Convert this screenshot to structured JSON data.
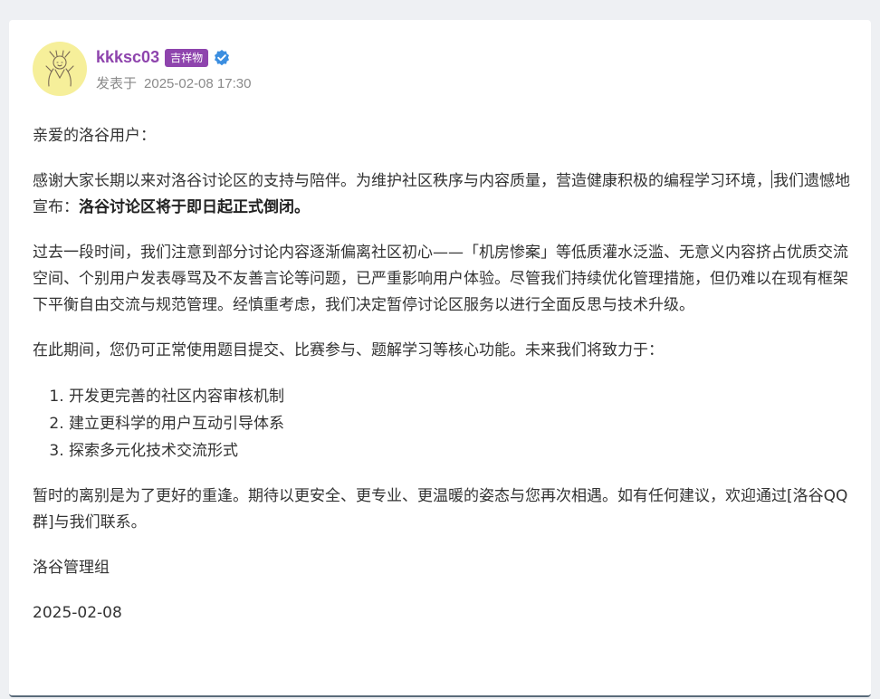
{
  "post": {
    "author": {
      "username": "kkksc03",
      "badge": "吉祥物",
      "verified_icon": "verified-check-icon",
      "avatar_icon": "avatar-sketch-icon"
    },
    "posted_label": "发表于",
    "posted_time": "2025-02-08 17:30",
    "colors": {
      "username": "#8e44ad",
      "badge_bg": "#8e44ad",
      "verified": "#3b8ee0",
      "avatar_bg": "#f6ef9a"
    }
  },
  "body": {
    "greeting": "亲爱的洛谷用户：",
    "p1_before": "感谢大家长期以来对洛谷讨论区的支持与陪伴。为维护社区秩序与内容质量，营造健康积极的编程学习环境，",
    "p1_after": "我们遗憾地宣布：",
    "p1_bold": "洛谷讨论区将于即日起正式倒闭。",
    "p2": "过去一段时间，我们注意到部分讨论内容逐渐偏离社区初心——「机房惨案」等低质灌水泛滥、无意义内容挤占优质交流空间、个别用户发表辱骂及不友善言论等问题，已严重影响用户体验。尽管我们持续优化管理措施，但仍难以在现有框架下平衡自由交流与规范管理。经慎重考虑，我们决定暂停讨论区服务以进行全面反思与技术升级。",
    "p3": "在此期间，您仍可正常使用题目提交、比赛参与、题解学习等核心功能。未来我们将致力于：",
    "list": [
      "开发更完善的社区内容审核机制",
      "建立更科学的用户互动引导体系",
      "探索多元化技术交流形式"
    ],
    "p4": "暂时的离别是为了更好的重逢。期待以更安全、更专业、更温暖的姿态与您再次相遇。如有任何建议，欢迎通过[洛谷QQ群]与我们联系。",
    "signature": "洛谷管理组",
    "date": "2025-02-08"
  }
}
